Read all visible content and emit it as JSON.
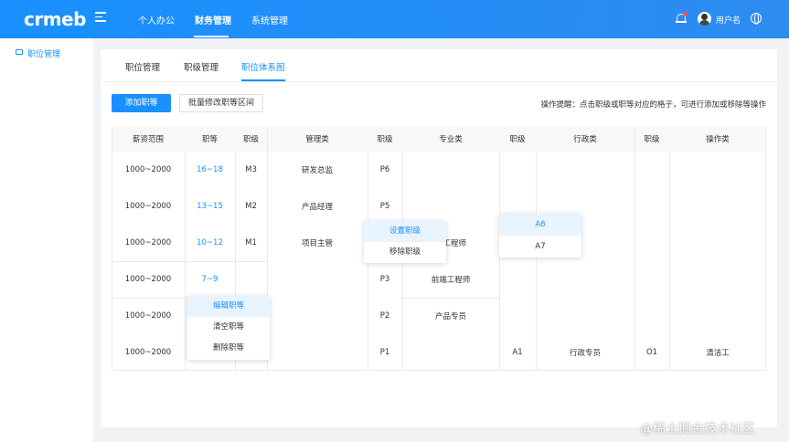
{
  "header": {
    "logo": "crmeb",
    "nav": [
      "个人办公",
      "财务管理",
      "系统管理"
    ],
    "active_nav": "财务管理",
    "username": "用户名",
    "icons": [
      "menu-toggle-icon",
      "bell-icon",
      "avatar",
      "globe-icon"
    ]
  },
  "sidebar": {
    "items": [
      {
        "label": "职位管理",
        "icon": "folder-icon"
      }
    ]
  },
  "tabs": [
    "职位管理",
    "职级管理",
    "职位体系图"
  ],
  "active_tab": "职位体系图",
  "toolbar": {
    "add_label": "添加职等",
    "batch_label": "批量修改职等区间",
    "tip": "操作提醒：点击职级或职等对应的格子，可进行添加或移除等操作"
  },
  "table": {
    "headers": [
      "薪资范围",
      "职等",
      "职级",
      "管理类",
      "职级",
      "专业类",
      "职级",
      "行政类",
      "职级",
      "操作类"
    ],
    "rows": [
      {
        "salary": "1000~2000",
        "grade": "16~18",
        "m_level": "M3",
        "m_title": "研发总监",
        "p_level": "P6",
        "p_title": "",
        "a_level": "",
        "a_title": "",
        "o_level": "",
        "o_title": ""
      },
      {
        "salary": "1000~2000",
        "grade": "13~15",
        "m_level": "M2",
        "m_title": "产品经理",
        "p_level": "P5",
        "p_title": "",
        "a_level": "",
        "a_title": "",
        "o_level": "",
        "o_title": ""
      },
      {
        "salary": "1000~2000",
        "grade": "10~12",
        "m_level": "M1",
        "m_title": "项目主管",
        "p_level": "",
        "p_title": "端工程师",
        "a_level": "",
        "a_title": "",
        "o_level": "",
        "o_title": ""
      },
      {
        "salary": "1000~2000",
        "grade": "7~9",
        "m_level": "",
        "m_title": "",
        "p_level": "P3",
        "p_title": "前端工程师",
        "a_level": "",
        "a_title": "",
        "o_level": "",
        "o_title": ""
      },
      {
        "salary": "1000~2000",
        "grade": "",
        "m_level": "",
        "m_title": "",
        "p_level": "P2",
        "p_title": "产品专员",
        "a_level": "",
        "a_title": "",
        "o_level": "",
        "o_title": ""
      },
      {
        "salary": "1000~2000",
        "grade": "",
        "m_level": "",
        "m_title": "",
        "p_level": "P1",
        "p_title": "",
        "a_level": "A1",
        "a_title": "行政专员",
        "o_level": "O1",
        "o_title": "清洁工"
      }
    ]
  },
  "popovers": {
    "level_menu": [
      "设置职级",
      "移除职级"
    ],
    "admin_levels": [
      "A6",
      "A7"
    ],
    "grade_menu": [
      "编辑职等",
      "清空职等",
      "删除职等"
    ]
  },
  "colors": {
    "primary": "#1890ff",
    "header_bg": "#1890ff",
    "page_bg": "#f0f2f5"
  },
  "watermark": "@稀土掘金技术社区"
}
